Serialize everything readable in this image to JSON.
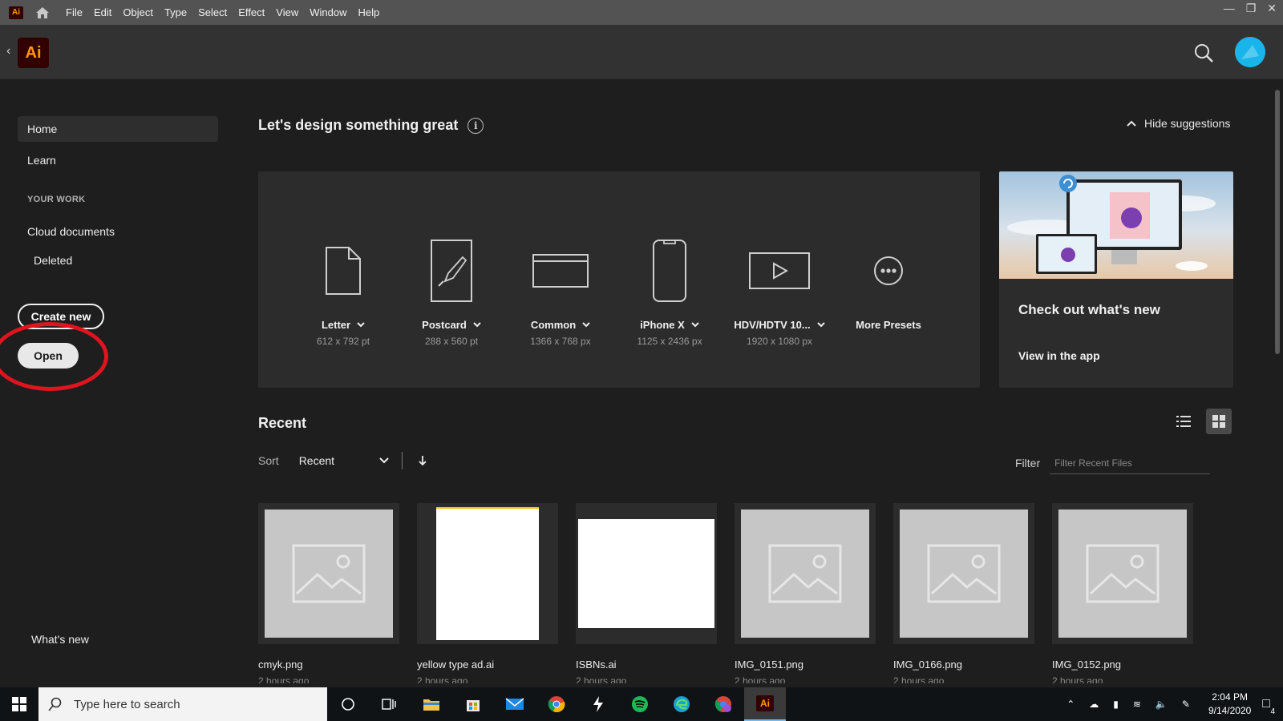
{
  "menubar": {
    "app_badge": "Ai",
    "menus": [
      "File",
      "Edit",
      "Object",
      "Type",
      "Select",
      "Effect",
      "View",
      "Window",
      "Help"
    ]
  },
  "header": {
    "logo_text": "Ai"
  },
  "sidebar": {
    "items": [
      {
        "label": "Home",
        "active": true
      },
      {
        "label": "Learn"
      }
    ],
    "section_label": "YOUR WORK",
    "work_items": [
      {
        "label": "Cloud documents"
      },
      {
        "label": "Deleted"
      }
    ],
    "create_new_label": "Create new",
    "open_label": "Open",
    "whats_new_label": "What's new"
  },
  "main": {
    "greeting": "Let's design something great",
    "info_glyph": "i",
    "hide_suggestions": "Hide suggestions",
    "presets": [
      {
        "name": "Letter",
        "dims": "612 x 792 pt",
        "icon": "document-icon",
        "dropdown": true
      },
      {
        "name": "Postcard",
        "dims": "288 x 560 pt",
        "icon": "brush-icon",
        "dropdown": true
      },
      {
        "name": "Common",
        "dims": "1366 x 768 px",
        "icon": "browser-window-icon",
        "dropdown": true
      },
      {
        "name": "iPhone X",
        "dims": "1125 x 2436 px",
        "icon": "phone-icon",
        "dropdown": true
      },
      {
        "name": "HDV/HDTV 10...",
        "dims": "1920 x 1080 px",
        "icon": "video-icon",
        "dropdown": true
      },
      {
        "name": "More Presets",
        "dims": "",
        "icon": "more-icon",
        "dropdown": false
      }
    ],
    "whats_new_card": {
      "title": "Check out what's new",
      "link": "View in the app"
    },
    "recent": {
      "title": "Recent",
      "sort_label": "Sort",
      "sort_value": "Recent",
      "filter_label": "Filter",
      "filter_placeholder": "Filter Recent Files",
      "files": [
        {
          "name": "cmyk.png",
          "time": "2 hours ago",
          "thumb": "placeholder"
        },
        {
          "name": "yellow type ad.ai",
          "time": "2 hours ago",
          "thumb": "portrait"
        },
        {
          "name": "ISBNs.ai",
          "time": "2 hours ago",
          "thumb": "landscape"
        },
        {
          "name": "IMG_0151.png",
          "time": "2 hours ago",
          "thumb": "placeholder"
        },
        {
          "name": "IMG_0166.png",
          "time": "2 hours ago",
          "thumb": "placeholder"
        },
        {
          "name": "IMG_0152.png",
          "time": "2 hours ago",
          "thumb": "placeholder"
        }
      ]
    }
  },
  "taskbar": {
    "search_placeholder": "Type here to search",
    "ai_badge": "Ai",
    "time": "2:04 PM",
    "date": "9/14/2020",
    "notification_count": "4"
  },
  "colors": {
    "accent_red": "#e0141e",
    "ai_orange": "#ff9a00",
    "ai_bg": "#330000",
    "avatar_blue": "#16b6e8"
  }
}
